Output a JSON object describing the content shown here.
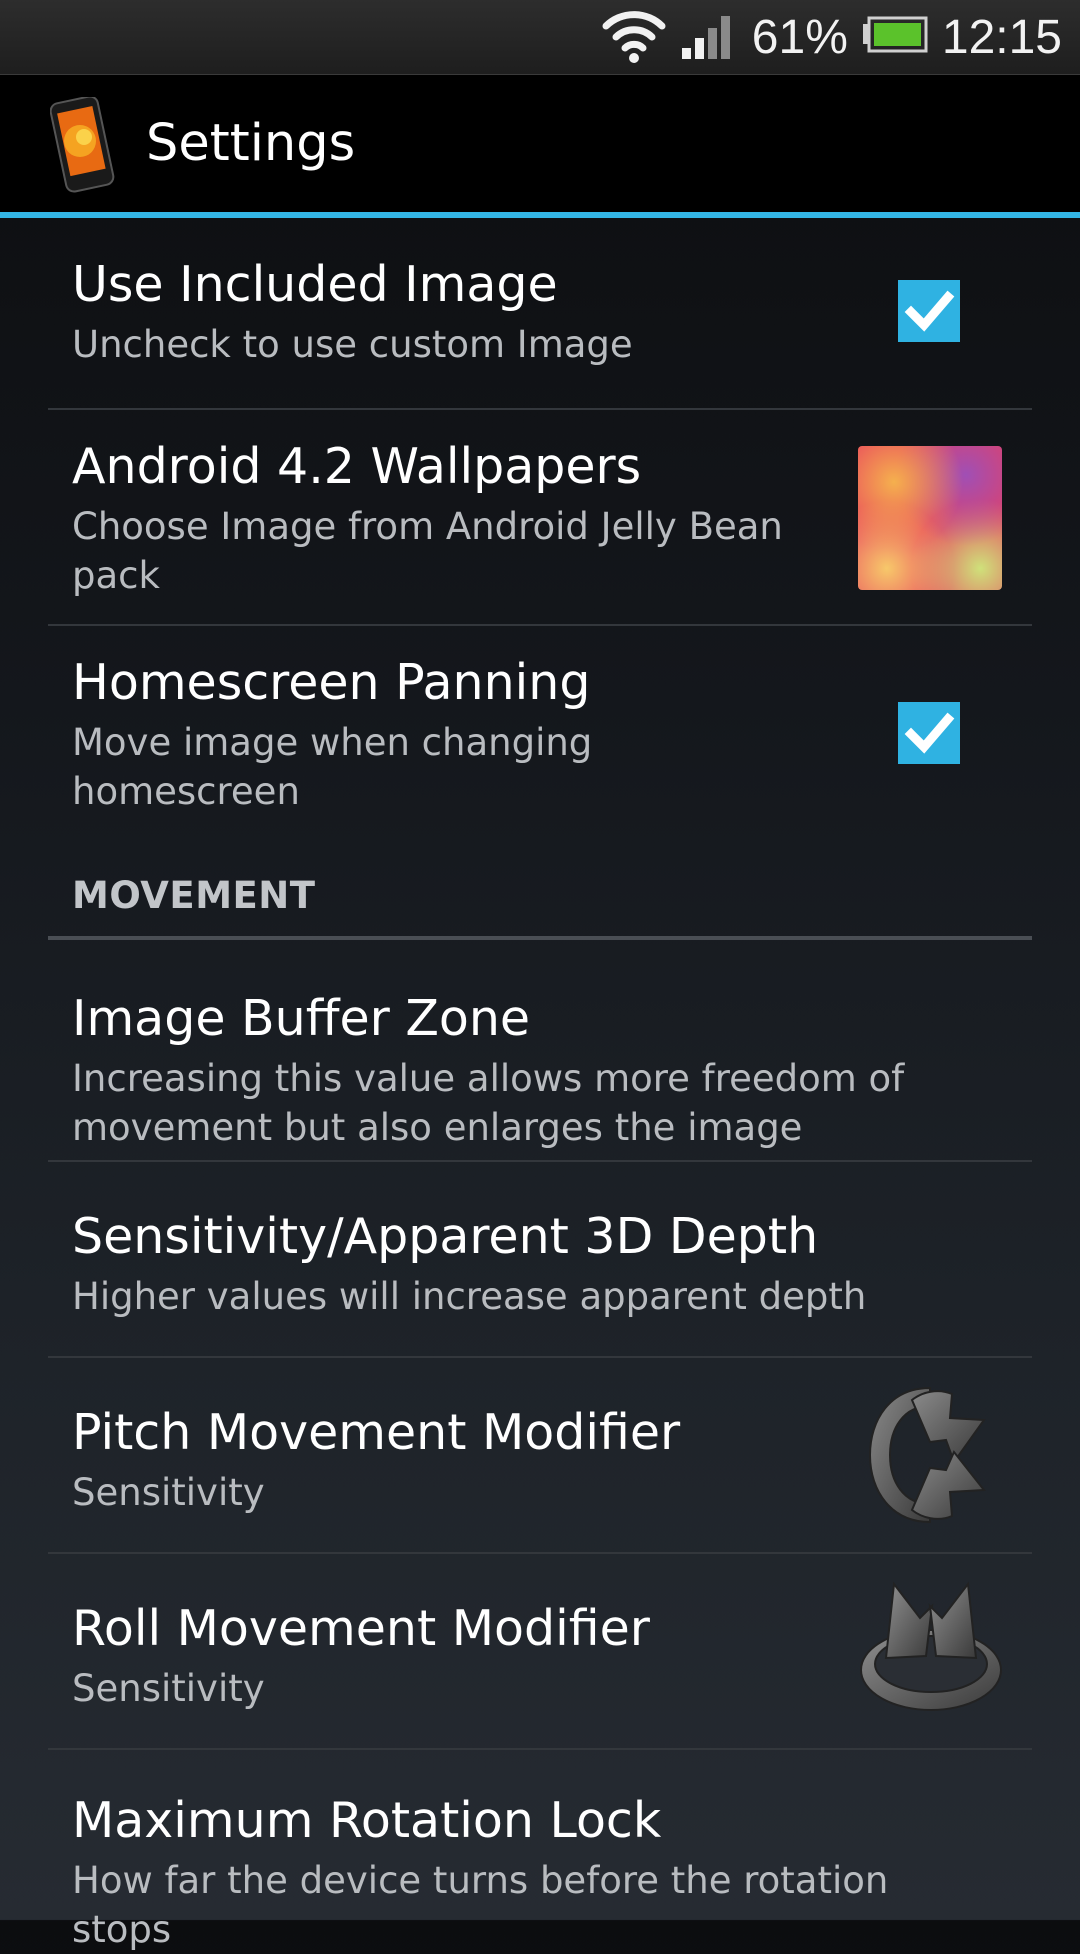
{
  "status_bar": {
    "battery_percent": "61%",
    "time": "12:15",
    "icons": [
      "wifi-icon",
      "signal-icon",
      "battery-icon"
    ],
    "battery_color": "#5bc22b"
  },
  "action_bar": {
    "title": "Settings",
    "accent_color": "#33b5e5"
  },
  "preferences": [
    {
      "title": "Use Included Image",
      "summary": "Uncheck to use custom Image",
      "widget": "checkbox",
      "checked": true
    },
    {
      "title": "Android 4.2 Wallpapers",
      "summary": "Choose Image from Android Jelly Bean pack",
      "widget": "wallpaper-thumbnail"
    },
    {
      "title": "Homescreen Panning",
      "summary": "Move image when changing homescreen",
      "widget": "checkbox",
      "checked": true
    }
  ],
  "sections": [
    {
      "header": "MOVEMENT",
      "items": [
        {
          "title": "Image Buffer Zone",
          "summary": "Increasing this value allows more freedom of movement but also enlarges the image"
        },
        {
          "title": "Sensitivity/Apparent 3D Depth",
          "summary": "Higher values will increase apparent depth"
        },
        {
          "title": "Pitch Movement Modifier",
          "summary": "Sensitivity",
          "widget": "pitch-rotation-icon"
        },
        {
          "title": "Roll Movement Modifier",
          "summary": "Sensitivity",
          "widget": "roll-rotation-icon"
        },
        {
          "title": "Maximum Rotation Lock",
          "summary": "How far the device turns before the rotation stops"
        }
      ]
    }
  ]
}
